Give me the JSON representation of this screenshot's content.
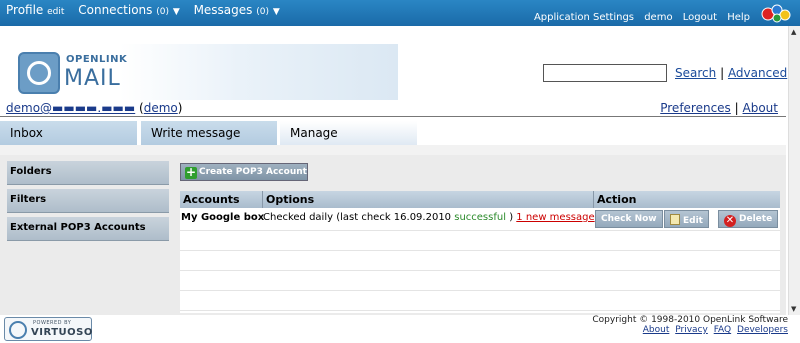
{
  "topbar": {
    "profile": "Profile",
    "profile_edit": "edit",
    "connections": "Connections",
    "connections_count": "(0)",
    "messages": "Messages",
    "messages_count": "(0)",
    "right_links": [
      "Application Settings",
      "demo",
      "Logout",
      "Help"
    ]
  },
  "header": {
    "logo_line1": "OPENLINK",
    "logo_line2": "MAIL",
    "search_value": "",
    "search_link": "Search",
    "search_separator": "|",
    "advanced_link": "Advanced"
  },
  "user": {
    "email": "demo@▬▬▬▬.▬▬▬",
    "name": "demo"
  },
  "top_links": {
    "preferences": "Preferences",
    "separator": "|",
    "about": "About"
  },
  "tabs": [
    "Inbox",
    "Write message",
    "Manage"
  ],
  "sidebar": {
    "items": [
      "Folders",
      "Filters",
      "External POP3 Accounts"
    ]
  },
  "main": {
    "create_button": "Create POP3 Account",
    "columns": [
      "Accounts",
      "Options",
      "Action"
    ],
    "rows": [
      {
        "account": "My Google box",
        "options_prefix": "Checked daily (last check 16.09.2010",
        "status": "successful",
        "options_suffix": ")",
        "new_messages": "1 new message",
        "actions": [
          "Check Now",
          "Edit",
          "Delete"
        ]
      }
    ]
  },
  "footer": {
    "powered_by": "POWERED BY",
    "virtuoso": "VIRTUOSO",
    "copyright": "Copyright © 1998-2010 OpenLink Software",
    "links": [
      "About",
      "Privacy",
      "FAQ",
      "Developers"
    ]
  }
}
